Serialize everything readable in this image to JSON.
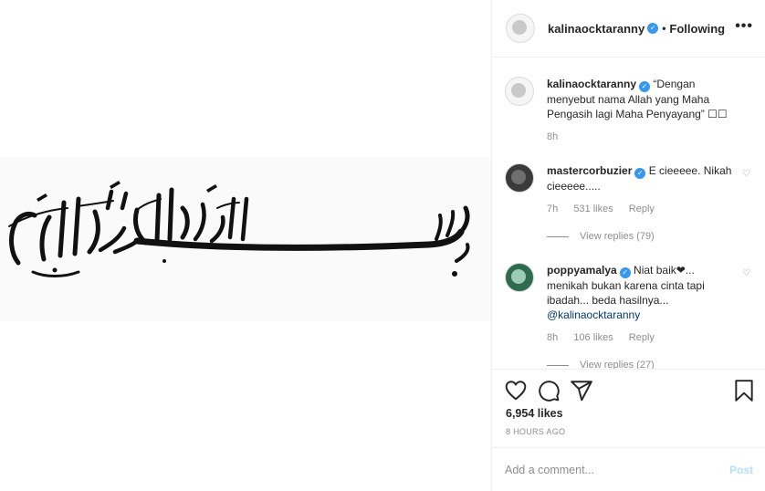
{
  "post": {
    "author": "kalinaocktaranny",
    "follow_status": "Following",
    "more_icon": "more-horizontal-icon",
    "image": {
      "subject": "Arabic calligraphy"
    }
  },
  "caption": {
    "author": "kalinaocktaranny",
    "text": "“Dengan menyebut nama Allah yang Maha Pengasih lagi Maha Penyayang” ☐☐",
    "age": "8h"
  },
  "comments": [
    {
      "author": "mastercorbuzier",
      "text": "E cieeeee. Nikah cieeeee.....",
      "age": "7h",
      "likes": "531 likes",
      "reply": "Reply",
      "view_replies": "View replies (79)"
    },
    {
      "author": "poppyamalya",
      "text": "Niat baik❤... menikah bukan karena cinta tapi ibadah... beda hasilnya...",
      "mention": "@kalinaocktaranny",
      "age": "8h",
      "likes": "106 likes",
      "reply": "Reply",
      "view_replies": "View replies (27)"
    }
  ],
  "actions": {
    "like_icon": "heart-icon",
    "comment_icon": "comment-icon",
    "share_icon": "share-icon",
    "save_icon": "bookmark-icon",
    "likes_count": "6,954 likes",
    "timestamp": "8 HOURS AGO"
  },
  "add_comment": {
    "placeholder": "Add a comment...",
    "post_label": "Post"
  },
  "colors": {
    "verified": "#3897f0",
    "post_disabled": "#b2dffc",
    "muted": "#8e8e8e"
  }
}
